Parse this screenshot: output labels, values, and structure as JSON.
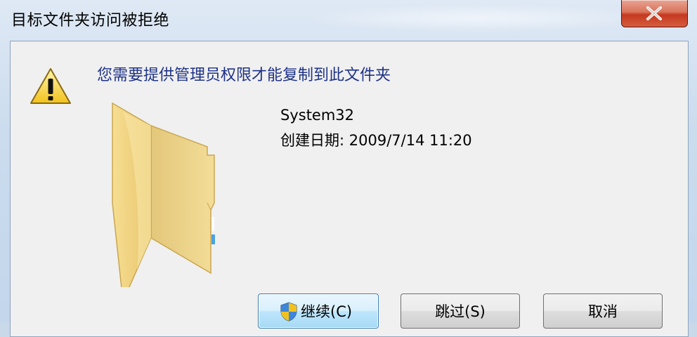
{
  "window": {
    "title": "目标文件夹访问被拒绝"
  },
  "dialog": {
    "message": "您需要提供管理员权限才能复制到此文件夹",
    "item_name": "System32",
    "item_date": "创建日期: 2009/7/14 11:20"
  },
  "buttons": {
    "continue": "继续(C)",
    "skip": "跳过(S)",
    "cancel": "取消"
  },
  "icons": {
    "warning": "warning-icon",
    "folder": "folder-icon",
    "close": "close-icon",
    "shield": "uac-shield-icon"
  }
}
